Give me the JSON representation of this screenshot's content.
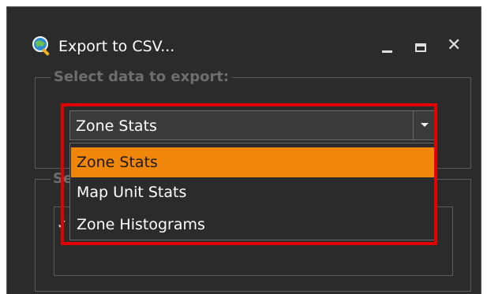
{
  "window": {
    "title": "Export to CSV...",
    "app_icon": "magnifier-globe-icon",
    "controls": [
      "minimize-icon",
      "maximize-icon",
      "close-icon"
    ]
  },
  "select_group": {
    "title": "Select data to export:",
    "combo": {
      "selected": "Zone Stats",
      "options": [
        "Zone Stats",
        "Map Unit Stats",
        "Zone Histograms"
      ],
      "highlighted_index": 0
    }
  },
  "second_group": {
    "title_partial": "Se"
  },
  "colors": {
    "window_bg": "#2b2b2b",
    "highlight_option": "#f0870a",
    "annotation_box": "#e30000"
  },
  "glyphs": {
    "close": "✕",
    "check": "✓"
  }
}
